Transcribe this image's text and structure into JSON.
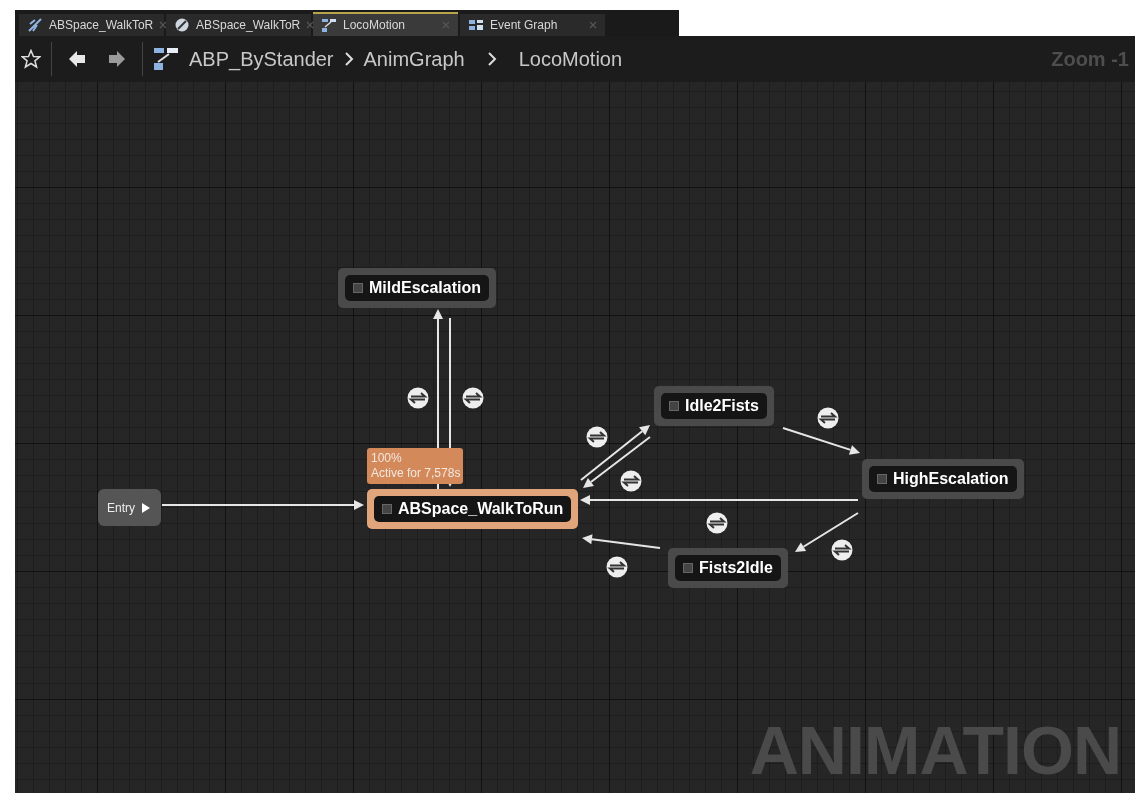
{
  "tabs": [
    {
      "label": "ABSpace_WalkToR",
      "kind": "blendspace",
      "selected": false
    },
    {
      "label": "ABSpace_WalkToR",
      "kind": "blendspace1d",
      "selected": false
    },
    {
      "label": "LocoMotion",
      "kind": "statemachine",
      "selected": true
    },
    {
      "label": "Event Graph",
      "kind": "eventgraph",
      "selected": false
    }
  ],
  "breadcrumb": [
    "ABP_ByStander",
    "AnimGraph",
    "LocoMotion"
  ],
  "zoom_label": "Zoom -1",
  "graph": {
    "entry": {
      "label": "Entry"
    },
    "states": [
      {
        "name": "MildEscalation",
        "active": false
      },
      {
        "name": "ABSpace_WalkToRun",
        "active": true
      },
      {
        "name": "Idle2Fists",
        "active": false
      },
      {
        "name": "HighEscalation",
        "active": false
      },
      {
        "name": "Fists2Idle",
        "active": false
      }
    ],
    "tooltip": {
      "weight": "100%",
      "time": "Active for 7,578s"
    },
    "graph_type_label": "ANIMATION"
  }
}
